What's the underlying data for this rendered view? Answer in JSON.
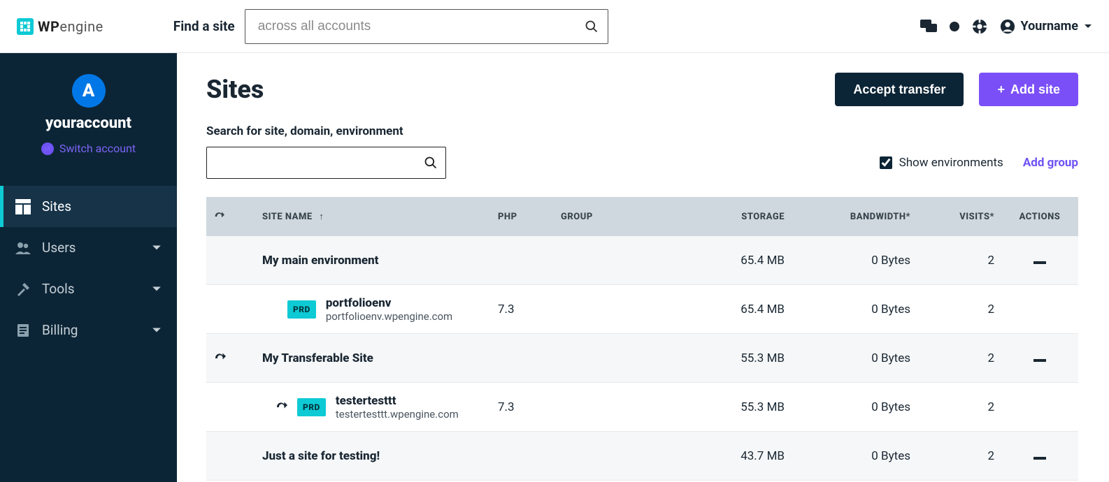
{
  "brand": {
    "name_bold": "WP",
    "name_light": "engine"
  },
  "topbar": {
    "find_label": "Find a site",
    "search_placeholder": "across all accounts",
    "username": "Yourname"
  },
  "sidebar": {
    "account_initial": "A",
    "account_name": "youraccount",
    "switch_label": "Switch account",
    "items": [
      {
        "label": "Sites",
        "active": true,
        "expandable": false
      },
      {
        "label": "Users",
        "active": false,
        "expandable": true
      },
      {
        "label": "Tools",
        "active": false,
        "expandable": true
      },
      {
        "label": "Billing",
        "active": false,
        "expandable": true
      }
    ]
  },
  "page": {
    "title": "Sites",
    "accept_transfer": "Accept transfer",
    "add_site": "Add site",
    "search_label": "Search for site, domain, environment",
    "show_env_label": "Show environments",
    "add_group": "Add group"
  },
  "table": {
    "headers": {
      "site_name": "SITE NAME",
      "php": "PHP",
      "group": "GROUP",
      "storage": "STORAGE",
      "bandwidth": "BANDWIDTH*",
      "visits": "VISITS*",
      "actions": "ACTIONS"
    },
    "rows": [
      {
        "type": "site",
        "transferable": false,
        "name": "My main environment",
        "php": "",
        "group": "",
        "storage": "65.4 MB",
        "bandwidth": "0 Bytes",
        "visits": "2",
        "actions": true
      },
      {
        "type": "env",
        "badge": "PRD",
        "env_name": "portfolioenv",
        "env_url": "portfolioenv.wpengine.com",
        "php": "7.3",
        "group": "",
        "storage": "65.4 MB",
        "bandwidth": "0 Bytes",
        "visits": "2",
        "actions": false,
        "transferable": false
      },
      {
        "type": "site",
        "transferable": true,
        "name": "My Transferable Site",
        "php": "",
        "group": "",
        "storage": "55.3 MB",
        "bandwidth": "0 Bytes",
        "visits": "2",
        "actions": true
      },
      {
        "type": "env",
        "badge": "PRD",
        "env_name": "testertesttt",
        "env_url": "testertesttt.wpengine.com",
        "php": "7.3",
        "group": "",
        "storage": "55.3 MB",
        "bandwidth": "0 Bytes",
        "visits": "2",
        "actions": false,
        "transferable": true
      },
      {
        "type": "site",
        "transferable": false,
        "name": "Just a site for testing!",
        "php": "",
        "group": "",
        "storage": "43.7 MB",
        "bandwidth": "0 Bytes",
        "visits": "2",
        "actions": true
      }
    ]
  }
}
